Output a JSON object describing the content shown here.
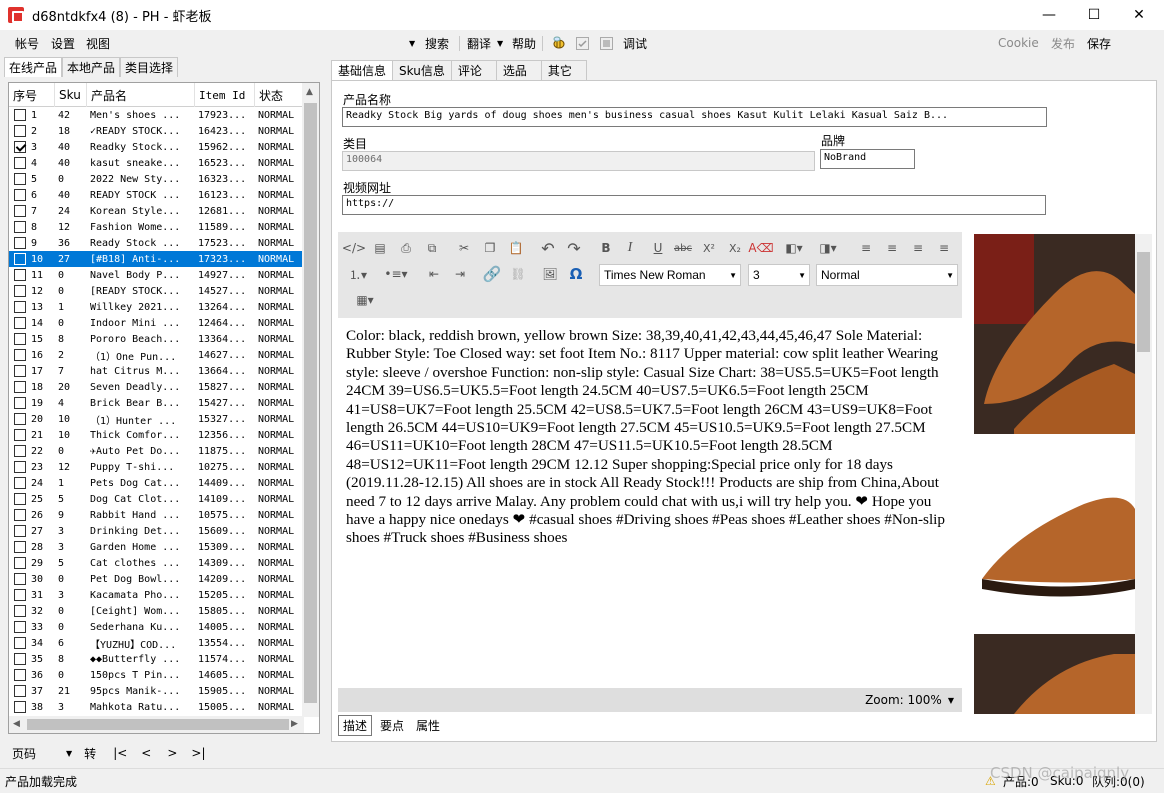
{
  "window": {
    "title": "d68ntdkfx4 (8) - PH - 虾老板",
    "min": "—",
    "max": "☐",
    "close": "✕"
  },
  "menu": {
    "account": "帐号",
    "settings": "设置",
    "view": "视图"
  },
  "toolbar": {
    "search": "搜索",
    "translate": "翻译",
    "help": "帮助",
    "debug": "调试",
    "cookie": "Cookie",
    "publish": "发布",
    "save": "保存"
  },
  "left_tabs": [
    "在线产品",
    "本地产品",
    "类目选择"
  ],
  "grid": {
    "headers": [
      "序号",
      "Sku",
      "产品名",
      "Item Id",
      "状态"
    ],
    "rows": [
      {
        "no": "1",
        "sku": "42",
        "name": "Men's shoes ...",
        "id": "17923...",
        "status": "NORMAL",
        "checked": false
      },
      {
        "no": "2",
        "sku": "18",
        "name": "✓READY STOCK...",
        "id": "16423...",
        "status": "NORMAL",
        "checked": false
      },
      {
        "no": "3",
        "sku": "40",
        "name": "Readky Stock...",
        "id": "15962...",
        "status": "NORMAL",
        "checked": true
      },
      {
        "no": "4",
        "sku": "40",
        "name": "kasut sneake...",
        "id": "16523...",
        "status": "NORMAL",
        "checked": false
      },
      {
        "no": "5",
        "sku": "0",
        "name": "2022 New Sty...",
        "id": "16323...",
        "status": "NORMAL",
        "checked": false
      },
      {
        "no": "6",
        "sku": "40",
        "name": "READY STOCK ...",
        "id": "16123...",
        "status": "NORMAL",
        "checked": false
      },
      {
        "no": "7",
        "sku": "24",
        "name": "Korean Style...",
        "id": "12681...",
        "status": "NORMAL",
        "checked": false
      },
      {
        "no": "8",
        "sku": "12",
        "name": "Fashion Wome...",
        "id": "11589...",
        "status": "NORMAL",
        "checked": false
      },
      {
        "no": "9",
        "sku": "36",
        "name": "Ready Stock ...",
        "id": "17523...",
        "status": "NORMAL",
        "checked": false
      },
      {
        "no": "10",
        "sku": "27",
        "name": "[#B18] Anti-...",
        "id": "17323...",
        "status": "NORMAL",
        "checked": false,
        "selected": true
      },
      {
        "no": "11",
        "sku": "0",
        "name": "Navel Body P...",
        "id": "14927...",
        "status": "NORMAL",
        "checked": false
      },
      {
        "no": "12",
        "sku": "0",
        "name": "[READY STOCK...",
        "id": "14527...",
        "status": "NORMAL",
        "checked": false
      },
      {
        "no": "13",
        "sku": "1",
        "name": "Willkey 2021...",
        "id": "13264...",
        "status": "NORMAL",
        "checked": false
      },
      {
        "no": "14",
        "sku": "0",
        "name": "Indoor Mini ...",
        "id": "12464...",
        "status": "NORMAL",
        "checked": false
      },
      {
        "no": "15",
        "sku": "8",
        "name": "Pororo Beach...",
        "id": "13364...",
        "status": "NORMAL",
        "checked": false
      },
      {
        "no": "16",
        "sku": "2",
        "name": "（1）One Pun...",
        "id": "14627...",
        "status": "NORMAL",
        "checked": false
      },
      {
        "no": "17",
        "sku": "7",
        "name": "hat Citrus M...",
        "id": "13664...",
        "status": "NORMAL",
        "checked": false
      },
      {
        "no": "18",
        "sku": "20",
        "name": "Seven Deadly...",
        "id": "15827...",
        "status": "NORMAL",
        "checked": false
      },
      {
        "no": "19",
        "sku": "4",
        "name": "Brick Bear B...",
        "id": "15427...",
        "status": "NORMAL",
        "checked": false
      },
      {
        "no": "20",
        "sku": "10",
        "name": "（1）Hunter ...",
        "id": "15327...",
        "status": "NORMAL",
        "checked": false
      },
      {
        "no": "21",
        "sku": "10",
        "name": "Thick Comfor...",
        "id": "12356...",
        "status": "NORMAL",
        "checked": false
      },
      {
        "no": "22",
        "sku": "0",
        "name": "✈Auto Pet Do...",
        "id": "11875...",
        "status": "NORMAL",
        "checked": false
      },
      {
        "no": "23",
        "sku": "12",
        "name": "Puppy  T-shi...",
        "id": "10275...",
        "status": "NORMAL",
        "checked": false
      },
      {
        "no": "24",
        "sku": "1",
        "name": "Pets Dog Cat...",
        "id": "14409...",
        "status": "NORMAL",
        "checked": false
      },
      {
        "no": "25",
        "sku": "5",
        "name": "Dog Cat Clot...",
        "id": "14109...",
        "status": "NORMAL",
        "checked": false
      },
      {
        "no": "26",
        "sku": "9",
        "name": "Rabbit Hand ...",
        "id": "10575...",
        "status": "NORMAL",
        "checked": false
      },
      {
        "no": "27",
        "sku": "3",
        "name": "Drinking Det...",
        "id": "15609...",
        "status": "NORMAL",
        "checked": false
      },
      {
        "no": "28",
        "sku": "3",
        "name": "Garden Home ...",
        "id": "15309...",
        "status": "NORMAL",
        "checked": false
      },
      {
        "no": "29",
        "sku": "5",
        "name": "Cat clothes ...",
        "id": "14309...",
        "status": "NORMAL",
        "checked": false
      },
      {
        "no": "30",
        "sku": "0",
        "name": "Pet Dog Bowl...",
        "id": "14209...",
        "status": "NORMAL",
        "checked": false
      },
      {
        "no": "31",
        "sku": "3",
        "name": "Kacamata Pho...",
        "id": "15205...",
        "status": "NORMAL",
        "checked": false
      },
      {
        "no": "32",
        "sku": "0",
        "name": "[Ceight] Wom...",
        "id": "15805...",
        "status": "NORMAL",
        "checked": false
      },
      {
        "no": "33",
        "sku": "0",
        "name": "Sederhana Ku...",
        "id": "14005...",
        "status": "NORMAL",
        "checked": false
      },
      {
        "no": "34",
        "sku": "6",
        "name": "【YUZHU】COD...",
        "id": "13554...",
        "status": "NORMAL",
        "checked": false
      },
      {
        "no": "35",
        "sku": "8",
        "name": "◆◆Butterfly ...",
        "id": "11574...",
        "status": "NORMAL",
        "checked": false
      },
      {
        "no": "36",
        "sku": "0",
        "name": "150pcs T Pin...",
        "id": "14605...",
        "status": "NORMAL",
        "checked": false
      },
      {
        "no": "37",
        "sku": "21",
        "name": "95pcs Manik-...",
        "id": "15905...",
        "status": "NORMAL",
        "checked": false
      },
      {
        "no": "38",
        "sku": "3",
        "name": "Mahkota Ratu...",
        "id": "15005...",
        "status": "NORMAL",
        "checked": false
      }
    ]
  },
  "pager": {
    "label": "页码",
    "go": "转",
    "first": "|<",
    "prev": "<",
    "next": ">",
    "last": ">|"
  },
  "status": {
    "left": "产品加载完成",
    "products": "产品:0",
    "sku": "Sku:0",
    "queue": "队列:0(0)",
    "watermark": "CSDN @caipaiqnly"
  },
  "right_tabs": [
    "基础信息",
    "Sku信息",
    "评论",
    "选品",
    "其它"
  ],
  "form": {
    "name_label": "产品名称",
    "name_value": "Readky Stock Big yards of doug shoes men's business casual shoes Kasut Kulit Lelaki Kasual Saiz B...",
    "category_label": "类目",
    "category_value": "100064",
    "brand_label": "品牌",
    "brand_value": "NoBrand",
    "video_label": "视频网址",
    "video_value": "https://"
  },
  "editor": {
    "font": "Times New Roman",
    "size": "3",
    "style": "Normal",
    "zoom": "Zoom: 100%",
    "content": "Color: black, reddish brown, yellow brown Size: 38,39,40,41,42,43,44,45,46,47 Sole Material: Rubber Style: Toe Closed way: set foot Item No.: 8117 Upper material: cow split leather Wearing style: sleeve / overshoe Function: non-slip style: Casual Size Chart: 38=US5.5=UK5=Foot length 24CM 39=US6.5=UK5.5=Foot length 24.5CM 40=US7.5=UK6.5=Foot length 25CM 41=US8=UK7=Foot length 25.5CM 42=US8.5=UK7.5=Foot length 26CM 43=US9=UK8=Foot length 26.5CM 44=US10=UK9=Foot length 27.5CM 45=US10.5=UK9.5=Foot length 27.5CM 46=US11=UK10=Foot length 28CM 47=US11.5=UK10.5=Foot length 28.5CM 48=US12=UK11=Foot length 29CM 12.12 Super shopping:Special price only for 18 days (2019.11.28-12.15) All shoes are in stock All Ready Stock!!! Products are ship from China,About need 7 to 12 days arrive Malay. Any problem could chat with us,i will try help you. ❤ Hope you have a happy nice onedays ❤         #casual shoes #Driving shoes #Peas shoes #Leather shoes #Non-slip shoes #Truck shoes #Business shoes"
  },
  "bottom_tabs": [
    "描述",
    "要点",
    "属性"
  ],
  "colors": {
    "selection": "#0078d7",
    "shoe": "#b5652a"
  }
}
